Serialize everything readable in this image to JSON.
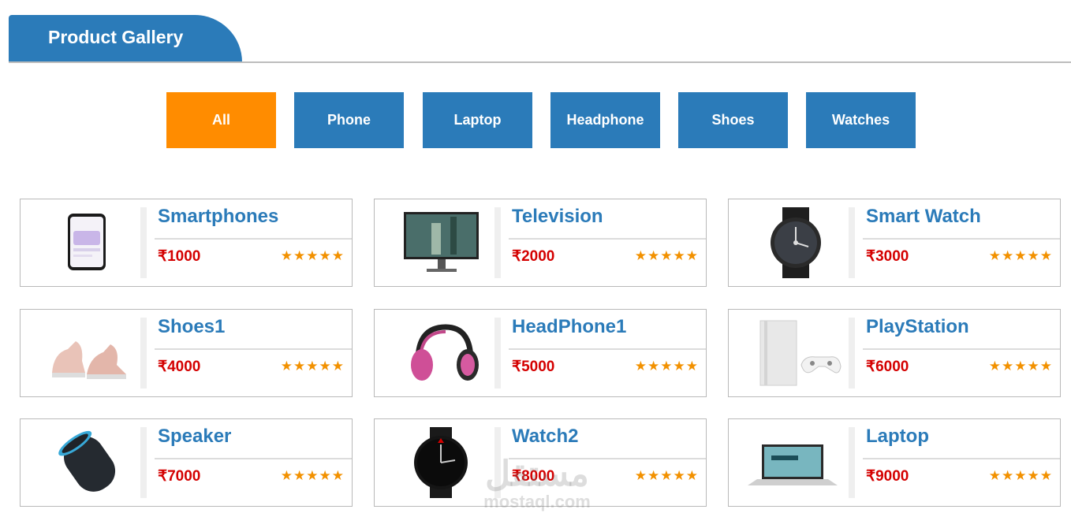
{
  "header": {
    "title": "Product Gallery"
  },
  "filters": [
    {
      "label": "All",
      "active": true
    },
    {
      "label": "Phone",
      "active": false
    },
    {
      "label": "Laptop",
      "active": false
    },
    {
      "label": "Headphone",
      "active": false
    },
    {
      "label": "Shoes",
      "active": false
    },
    {
      "label": "Watches",
      "active": false
    }
  ],
  "products": [
    {
      "name": "Smartphones",
      "price": "₹1000",
      "rating": "★★★★★",
      "icon": "smartphone-image"
    },
    {
      "name": "Television",
      "price": "₹2000",
      "rating": "★★★★★",
      "icon": "television-image"
    },
    {
      "name": "Smart Watch",
      "price": "₹3000",
      "rating": "★★★★★",
      "icon": "smart-watch-image"
    },
    {
      "name": "Shoes1",
      "price": "₹4000",
      "rating": "★★★★★",
      "icon": "shoes-image"
    },
    {
      "name": "HeadPhone1",
      "price": "₹5000",
      "rating": "★★★★★",
      "icon": "headphone-image"
    },
    {
      "name": "PlayStation",
      "price": "₹6000",
      "rating": "★★★★★",
      "icon": "playstation-image"
    },
    {
      "name": "Speaker",
      "price": "₹7000",
      "rating": "★★★★★",
      "icon": "speaker-image"
    },
    {
      "name": "Watch2",
      "price": "₹8000",
      "rating": "★★★★★",
      "icon": "watch-image"
    },
    {
      "name": "Laptop",
      "price": "₹9000",
      "rating": "★★★★★",
      "icon": "laptop-image"
    }
  ],
  "colors": {
    "primary": "#2b7bb9",
    "active": "#ff8c00",
    "price": "#d40000",
    "star": "#f29100"
  },
  "watermark": {
    "arabic": "مستقل",
    "latin": "mostaql.com"
  }
}
